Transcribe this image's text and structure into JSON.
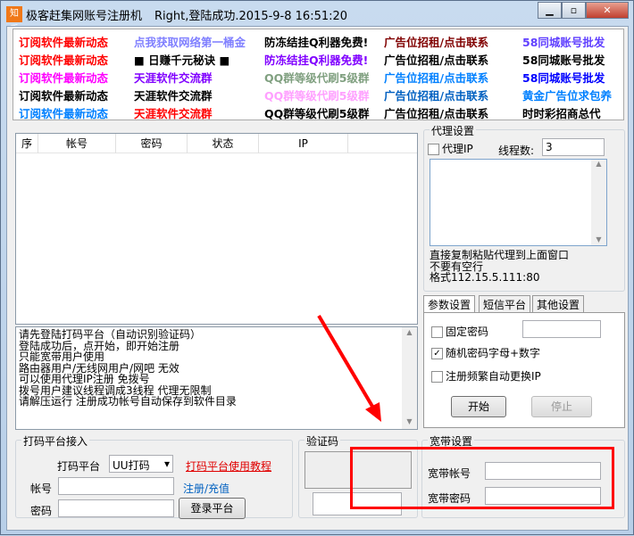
{
  "window": {
    "icon_text": "知乎",
    "title": "极客赶集网账号注册机",
    "status": "Right,登陆成功.2015-9-8 16:51:20"
  },
  "links": [
    [
      {
        "text": "订阅软件最新动态",
        "color": "#ff0000"
      },
      {
        "text": "点我获取网络第一桶金",
        "color": "#8080ff"
      },
      {
        "text": "防冻结挂Q利器免费!",
        "color": "#000000"
      },
      {
        "text": "广告位招租/点击联系",
        "color": "#800000"
      },
      {
        "text": "58同城账号批发",
        "color": "#6040ff"
      }
    ],
    [
      {
        "text": "订阅软件最新动态",
        "color": "#ff0000"
      },
      {
        "text": "■ 日赚千元秘诀 ■",
        "color": "#000000"
      },
      {
        "text": "防冻结挂Q利器免费!",
        "color": "#8000ff"
      },
      {
        "text": "广告位招租/点击联系",
        "color": "#000000"
      },
      {
        "text": "58同城账号批发",
        "color": "#000000"
      }
    ],
    [
      {
        "text": "订阅软件最新动态",
        "color": "#ff00ff"
      },
      {
        "text": "天涯软件交流群",
        "color": "#8000ff"
      },
      {
        "text": "QQ群等级代刷5级群",
        "color": "#80a080"
      },
      {
        "text": "广告位招租/点击联系",
        "color": "#0080ff"
      },
      {
        "text": "58同城账号批发",
        "color": "#0000ff"
      }
    ],
    [
      {
        "text": "订阅软件最新动态",
        "color": "#000000"
      },
      {
        "text": "天涯软件交流群",
        "color": "#000000"
      },
      {
        "text": "QQ群等级代刷5级群",
        "color": "#ffa0ff"
      },
      {
        "text": "广告位招租/点击联系",
        "color": "#0060c0"
      },
      {
        "text": "黄金广告位求包养",
        "color": "#0080ff"
      }
    ],
    [
      {
        "text": "订阅软件最新动态",
        "color": "#0080ff"
      },
      {
        "text": "天涯软件交流群",
        "color": "#ff0000"
      },
      {
        "text": "QQ群等级代刷5级群",
        "color": "#000000"
      },
      {
        "text": "广告位招租/点击联系",
        "color": "#000000"
      },
      {
        "text": "时时彩招商总代",
        "color": "#000000"
      }
    ]
  ],
  "table": {
    "columns": [
      "序",
      "帐号",
      "密码",
      "状态",
      "IP"
    ]
  },
  "log": [
    "请先登陆打码平台（自动识别验证码）",
    "登陆成功后，点开始，即开始注册",
    "只能宽带用户使用",
    "路由器用户/无线网用户/网吧 无效",
    "可以使用代理IP注册 免拨号",
    "拨号用户建议线程调成3线程 代理无限制",
    "请解压运行 注册成功帐号自动保存到软件目录"
  ],
  "proxy": {
    "group": "代理设置",
    "use_proxy": "代理IP",
    "threads_label": "线程数:",
    "threads": "3",
    "hint1": "直接复制粘贴代理到上面窗口",
    "hint2": "不要有空行",
    "hint3": "格式112.15.5.111:80"
  },
  "tabs": [
    "参数设置",
    "短信平台",
    "其他设置"
  ],
  "params": {
    "fixed_pwd": "固定密码",
    "random_pwd": "随机密码字母+数字",
    "auto_ip": "注册频繁自动更换IP",
    "start": "开始",
    "stop": "停止"
  },
  "captcha_platform": {
    "group": "打码平台接入",
    "platform_label": "打码平台",
    "platform": "UU打码",
    "tutorial": "打码平台使用教程",
    "account_label": "帐号",
    "register": "注册/充值",
    "password_label": "密码",
    "login": "登录平台"
  },
  "captcha": {
    "group": "验证码"
  },
  "broadband": {
    "group": "宽带设置",
    "account_label": "宽带帐号",
    "password_label": "宽带密码"
  },
  "annotation_color": "#ff0000"
}
